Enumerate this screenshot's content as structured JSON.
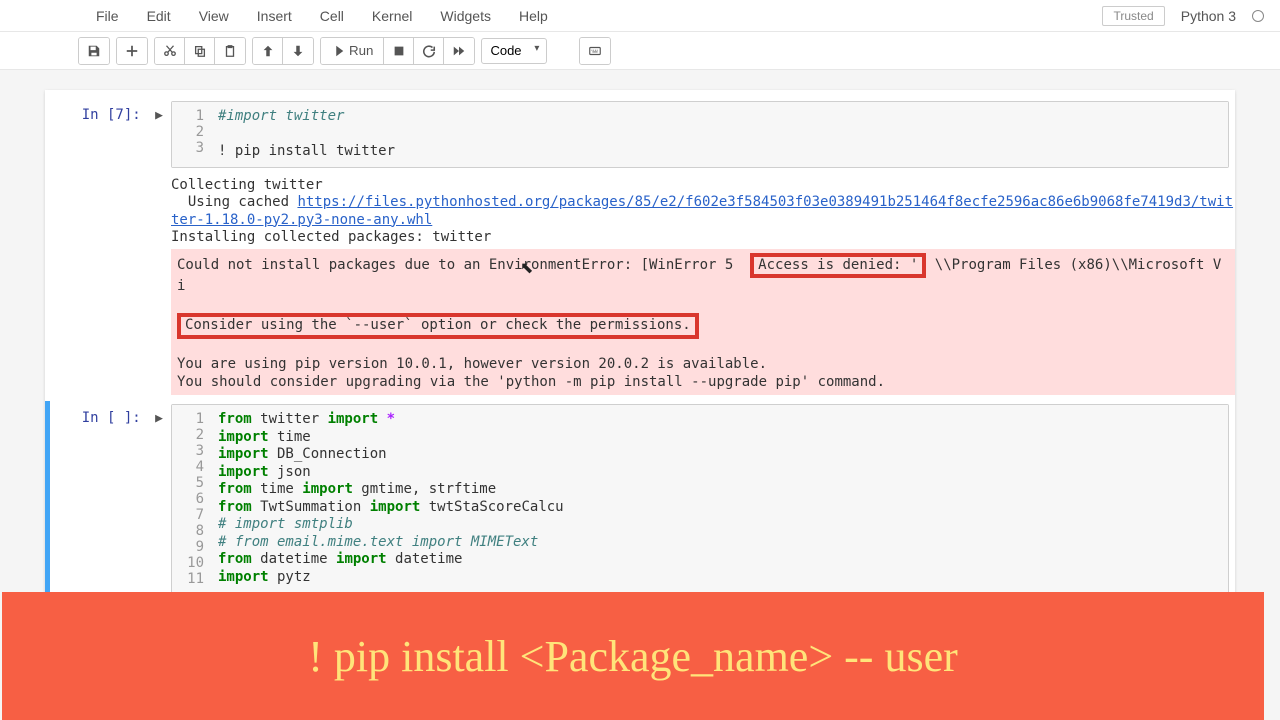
{
  "menubar": {
    "items": [
      "File",
      "Edit",
      "View",
      "Insert",
      "Cell",
      "Kernel",
      "Widgets",
      "Help"
    ],
    "trusted": "Trusted",
    "kernel": "Python 3"
  },
  "toolbar": {
    "run_label": "Run",
    "cell_type": "Code"
  },
  "cells": [
    {
      "prompt": "In [7]:",
      "lines": [
        "1",
        "2",
        "3"
      ],
      "code": {
        "l1": "#import twitter",
        "l3_bang": "! ",
        "l3_rest": "pip install twitter"
      },
      "output": {
        "line1": "Collecting twitter",
        "line2a": "  Using cached ",
        "line2b": "https://files.pythonhosted.org/packages/85/e2/f602e3f584503f03e0389491b251464f8ecfe2596ac86e6b9068fe7419d3/twitter-1.18.0-py2.py3-none-any.whl",
        "line3": "Installing collected packages: twitter",
        "err1a": "Could not install packages due to an EnvironmentError: [WinError 5 ",
        "err1_highlight": "Access is denied: '",
        "err1b": "\\\\Program Files (x86)\\\\Microsoft Vi",
        "err2": "Consider using the `--user` option or check the permissions.",
        "warn1": "You are using pip version 10.0.1, however version 20.0.2 is available.",
        "warn2": "You should consider upgrading via the 'python -m pip install --upgrade pip' command."
      }
    },
    {
      "prompt": "In [ ]:",
      "lines": [
        "1",
        "2",
        "3",
        "4",
        "5",
        "6",
        "7",
        "8",
        "9",
        "10",
        "11"
      ],
      "code": {
        "l1": {
          "a": "from",
          "b": " twitter ",
          "c": "import",
          "d": " ",
          "e": "*"
        },
        "l2": {
          "a": "import",
          "b": " time"
        },
        "l3": {
          "a": "import",
          "b": " DB_Connection"
        },
        "l4": {
          "a": "import",
          "b": " json"
        },
        "l5": {
          "a": "from",
          "b": " time ",
          "c": "import",
          "d": " gmtime, strftime"
        },
        "l6": {
          "a": "from",
          "b": " TwtSummation ",
          "c": "import",
          "d": " twtStaScoreCalcu"
        },
        "l7": "# import smtplib",
        "l8": "# from email.mime.text import MIMEText",
        "l9": {
          "a": "from",
          "b": " datetime ",
          "c": "import",
          "d": " datetime"
        },
        "l10": {
          "a": "import",
          "b": " pytz"
        }
      }
    }
  ],
  "caption": "! pip install <Package_name> -- user"
}
